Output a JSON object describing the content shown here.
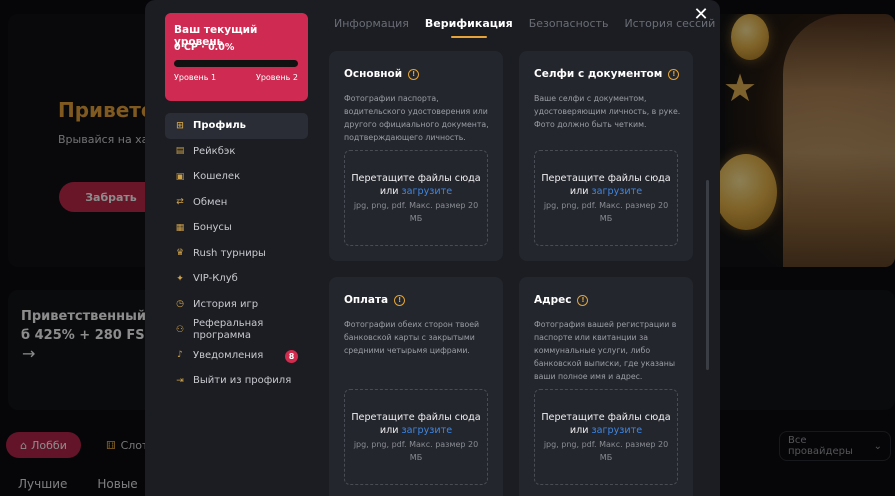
{
  "background": {
    "hero_title": "Приветс",
    "hero_subtitle": "Врывайся на хай",
    "hero_button": "Забрать",
    "bonus_title": "Приветственный б 425% + 280 FS",
    "bonus_arrow": "→",
    "lobby_label": "Лобби",
    "slots_label": "Слот",
    "providers_label": "Все провайдеры",
    "bottom_tabs": [
      "Лучшие",
      "Новые"
    ]
  },
  "level_card": {
    "title": "Ваш текущий уровень",
    "value": "0 СР · 0.0%",
    "progress": 0.0,
    "level_from": "Уровень 1",
    "level_to": "Уровень 2"
  },
  "menu": [
    {
      "label": "Профиль",
      "icon": "grid-icon",
      "glyph": "⊞",
      "active": true
    },
    {
      "label": "Рейкбэк",
      "icon": "rakeback-icon",
      "glyph": "▤"
    },
    {
      "label": "Кошелек",
      "icon": "wallet-icon",
      "glyph": "▣"
    },
    {
      "label": "Обмен",
      "icon": "exchange-icon",
      "glyph": "⇄"
    },
    {
      "label": "Бонусы",
      "icon": "gift-icon",
      "glyph": "▦"
    },
    {
      "label": "Rush турниры",
      "icon": "trophy-icon",
      "glyph": "♛"
    },
    {
      "label": "VIP-Клуб",
      "icon": "vip-icon",
      "glyph": "✦"
    },
    {
      "label": "История игр",
      "icon": "history-icon",
      "glyph": "◷"
    },
    {
      "label": "Реферальная программа",
      "icon": "referral-icon",
      "glyph": "⚇"
    },
    {
      "label": "Уведомления",
      "icon": "bell-icon",
      "glyph": "♪",
      "badge": "8"
    },
    {
      "label": "Выйти из профиля",
      "icon": "logout-icon",
      "glyph": "⇥"
    }
  ],
  "tabs": [
    "Информация",
    "Верификация",
    "Безопасность",
    "История сессий"
  ],
  "active_tab": "Верификация",
  "close_label": "✕",
  "info_icon_glyph": "!",
  "cards": [
    {
      "title": "Основной",
      "description": "Фотографии паспорта, водительского удостоверения или другого официального документа, подтверждающего личность."
    },
    {
      "title": "Селфи с документом",
      "description": "Ваше селфи с документом, удостоверяющим личность, в руке. Фото должно быть четким."
    },
    {
      "title": "Оплата",
      "description": "Фотографии обеих сторон твоей банковской карты с закрытыми средними четырьмя цифрами."
    },
    {
      "title": "Адрес",
      "description": "Фотография вашей регистрации в паспорте или квитанции за коммунальные услуги, либо банковской выписки, где указаны ваши полное имя и адрес."
    }
  ],
  "dropzone": {
    "text": "Перетащите файлы сюда",
    "or": "или",
    "link": "загрузите",
    "hint": "jpg, png, pdf. Макс. размер 20 МБ"
  },
  "colors": {
    "accent": "#cf2b52",
    "gold": "#e8a23a",
    "link": "#3f86e0",
    "modal_bg": "#1b1d23",
    "card_bg": "#24262d"
  }
}
